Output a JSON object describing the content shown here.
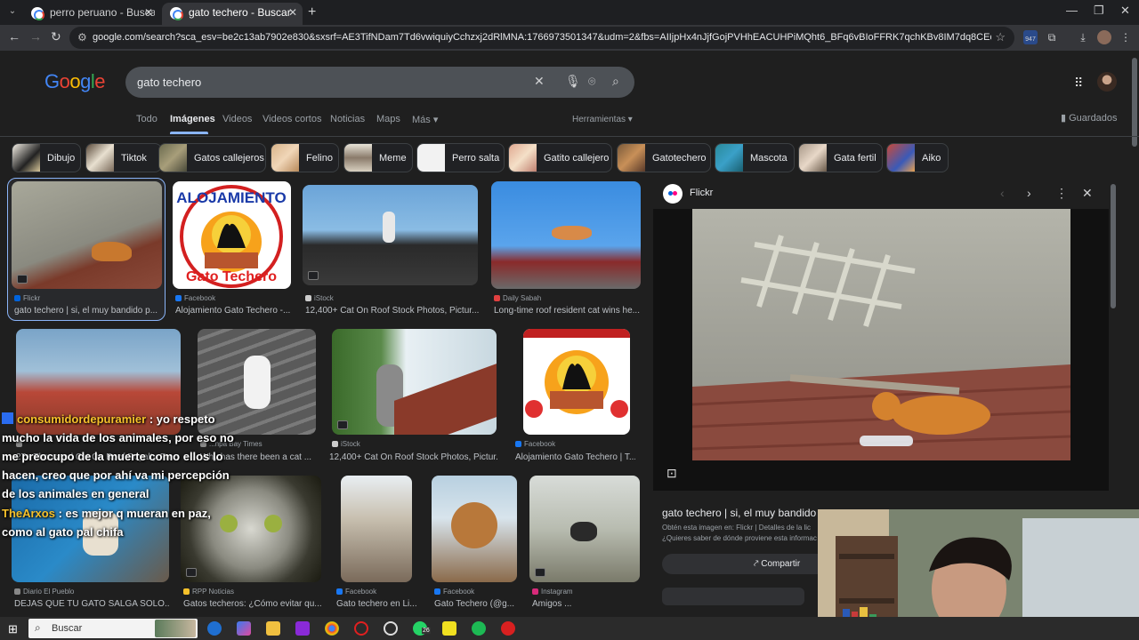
{
  "browser": {
    "tabs": [
      {
        "title": "perro peruano - Buscar con Go",
        "active": false
      },
      {
        "title": "gato techero - Buscar con Goo",
        "active": true
      }
    ],
    "url": "google.com/search?sca_esv=be2c13ab7902e830&sxsrf=AE3TifNDam7Td6vwiquiyCchzxj2dRlMNA:1766973501347&udm=2&fbs=AIIjpHx4nJjfGojPVHhEACUHPiMQht6_BFq6vBIoFFRK7qchKBv8IM7dq8CEqHDU38N7IbIo0LLC9Cn6mkAPuJ2pf_5AB...",
    "extension_badge": "947"
  },
  "google": {
    "logo": "Google",
    "query": "gato techero",
    "nav": [
      "Todo",
      "Imágenes",
      "Videos",
      "Videos cortos",
      "Noticias",
      "Maps",
      "Más"
    ],
    "nav_active": "Imágenes",
    "tools": "Herramientas",
    "saved": "Guardados",
    "chips": [
      "Dibujo",
      "Tiktok",
      "Gatos callejeros",
      "Felino",
      "Meme",
      "Perro salta",
      "Gatito callejero",
      "Gatotechero",
      "Mascota",
      "Gata fertil",
      "Aiko"
    ]
  },
  "results": [
    {
      "source": "Flickr",
      "title": "gato techero | si, el muy bandido p..."
    },
    {
      "source": "Facebook",
      "title": "Alojamiento Gato Techero -..."
    },
    {
      "source": "iStock",
      "title": "12,400+ Cat On Roof Stock Photos, Pictur..."
    },
    {
      "source": "Daily Sabah",
      "title": "Long-time roof resident cat wins he..."
    },
    {
      "source": "",
      "title": "27+ Thousand Cat On Roof Royalty-Free I..."
    },
    {
      "source": "...npa Bay Times",
      "title": "Why has there been a cat ..."
    },
    {
      "source": "iStock",
      "title": "12,400+ Cat On Roof Stock Photos, Pictur..."
    },
    {
      "source": "Facebook",
      "title": "Alojamiento Gato Techero | T..."
    },
    {
      "source": "Diario El Pueblo",
      "title": "DEJAS QUE TU GATO SALGA SOLO..."
    },
    {
      "source": "RPP Noticias",
      "title": "Gatos techeros: ¿Cómo evitar qu..."
    },
    {
      "source": "Facebook",
      "title": "Gato techero en Li..."
    },
    {
      "source": "Facebook",
      "title": "Gato Techero (@g..."
    },
    {
      "source": "Instagram",
      "title": "Amigos ..."
    }
  ],
  "logo_image": {
    "top_text": "ALOJAMIENTO",
    "bottom_text": "Gato Techero"
  },
  "panel": {
    "site": "Flickr",
    "title": "gato techero | si, el muy bandido",
    "info_line1": "Obtén esta imagen en: Flickr | Detalles de la lic",
    "info_line2": "¿Quieres saber de dónde proviene esta informac",
    "share": "Compartir"
  },
  "chat": [
    {
      "user": "consumidordepuramier",
      "message": ": yo respeto mucho la vida de los animales, por eso no me preocupo de la muerte como ellos lo hacen, creo que por ahí va mi percepción de los animales en general"
    },
    {
      "user": "TheArxos",
      "message": ": es mejor q mueran en paz, como al gato pal chifa"
    }
  ],
  "taskbar": {
    "search": "Buscar",
    "whatsapp_badge": "26"
  }
}
